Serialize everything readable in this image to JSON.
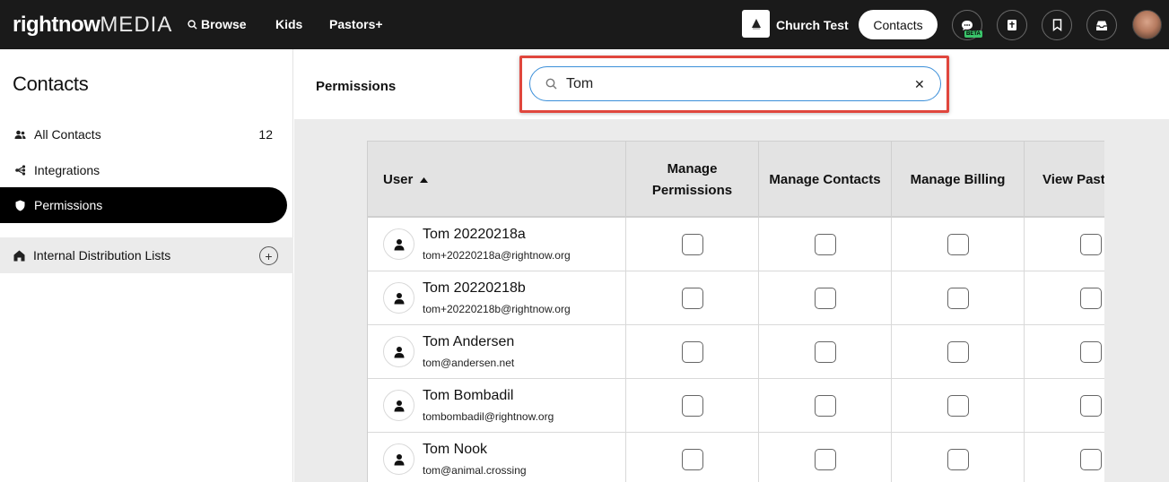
{
  "topbar": {
    "logo_bold": "rightnow",
    "logo_light": "MEDIA",
    "nav": [
      {
        "label": "Browse",
        "icon": "search-icon"
      },
      {
        "label": "Kids"
      },
      {
        "label": "Pastors+"
      }
    ],
    "church_name": "Church Test",
    "contacts_label": "Contacts",
    "beta_label": "BETA",
    "icons": [
      "chat-icon",
      "bible-icon",
      "bookmark-icon",
      "inbox-icon",
      "avatar"
    ]
  },
  "sidebar": {
    "title": "Contacts",
    "items": [
      {
        "label": "All Contacts",
        "count": "12",
        "icon": "users-icon"
      },
      {
        "label": "Integrations",
        "count": "",
        "icon": "integrations-icon"
      },
      {
        "label": "Permissions",
        "count": "",
        "icon": "shield-icon",
        "active": true
      }
    ],
    "group": {
      "label": "Internal Distribution Lists",
      "icon": "home-icon",
      "add_label": "+"
    }
  },
  "main": {
    "title": "Permissions",
    "search": {
      "value": "Tom",
      "placeholder": "Search",
      "clear_label": "✕"
    }
  },
  "table": {
    "columns": [
      {
        "label": "User",
        "sorted": "ascending"
      },
      {
        "label": "Manage Permissions"
      },
      {
        "label": "Manage Contacts"
      },
      {
        "label": "Manage Billing"
      },
      {
        "label": "View Past"
      }
    ],
    "rows": [
      {
        "name": "Tom 20220218a",
        "email": "tom+20220218a@rightnow.org"
      },
      {
        "name": "Tom 20220218b",
        "email": "tom+20220218b@rightnow.org"
      },
      {
        "name": "Tom Andersen",
        "email": "tom@andersen.net"
      },
      {
        "name": "Tom Bombadil",
        "email": "tombombadil@rightnow.org"
      },
      {
        "name": "Tom Nook",
        "email": "tom@animal.crossing"
      }
    ]
  },
  "colors": {
    "topbar": "#1a1a1a",
    "highlight": "#e0463d",
    "search_border": "#3b8fd9",
    "beta": "#3ac46a"
  }
}
